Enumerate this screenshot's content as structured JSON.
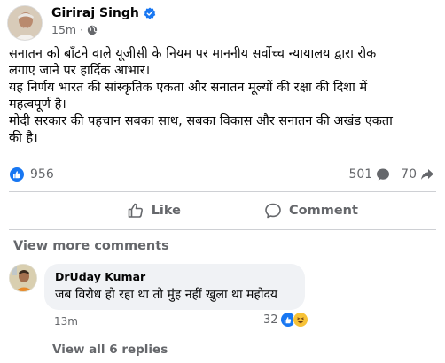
{
  "post": {
    "author_name": "Giriraj Singh",
    "verified_icon": "verified-badge-icon",
    "time": "15m",
    "separator": "·",
    "audience_icon": "globe-icon",
    "body_lines": [
      "सनातन को बाँटने वाले यूजीसी के नियम पर माननीय सर्वोच्च न्यायालय द्वारा रोक",
      "लगाए जाने पर हार्दिक आभार।",
      "यह निर्णय भारत की सांस्कृतिक एकता और सनातन मूल्यों की रक्षा की दिशा में",
      "महत्वपूर्ण है।",
      "मोदी सरकार की पहचान सबका साथ, सबका विकास और सनातन की अखंड एकता",
      "की है।"
    ]
  },
  "stats": {
    "reactions_count": "956",
    "comments_count": "501",
    "shares_count": "70"
  },
  "actions": {
    "like_label": "Like",
    "comment_label": "Comment"
  },
  "comments_section": {
    "view_more_label": "View more comments",
    "comment": {
      "author": "DrUday Kumar",
      "text": "जब विरोध हो रहा था तो मुंह नहीं खुला था महोदय",
      "time": "13m",
      "reactions_count": "32"
    },
    "view_replies_label": "View all 6 replies"
  },
  "colors": {
    "accent": "#1877f2",
    "secondary_text": "#65676b",
    "bubble_bg": "#f0f2f5"
  }
}
